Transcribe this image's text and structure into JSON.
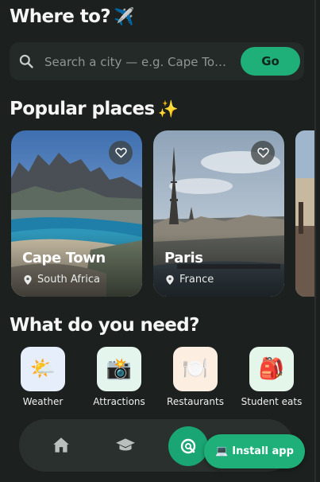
{
  "header": {
    "title": "Where to?",
    "emoji": "✈️"
  },
  "search": {
    "placeholder": "Search a city — e.g. Cape To…",
    "go_label": "Go"
  },
  "popular": {
    "title": "Popular places",
    "emoji": "✨",
    "places": [
      {
        "name": "Cape Town",
        "country": "South Africa"
      },
      {
        "name": "Paris",
        "country": "France"
      }
    ]
  },
  "needs": {
    "title": "What do you need?",
    "items": [
      {
        "label": "Weather",
        "emoji": "🌤️"
      },
      {
        "label": "Attractions",
        "emoji": "📸"
      },
      {
        "label": "Restaurants",
        "emoji": "🍽️"
      },
      {
        "label": "Student eats",
        "emoji": "🎒"
      }
    ]
  },
  "install": {
    "label": "Install app",
    "emoji": "💻"
  },
  "colors": {
    "accent": "#1fb07a",
    "background": "#1c201e"
  }
}
